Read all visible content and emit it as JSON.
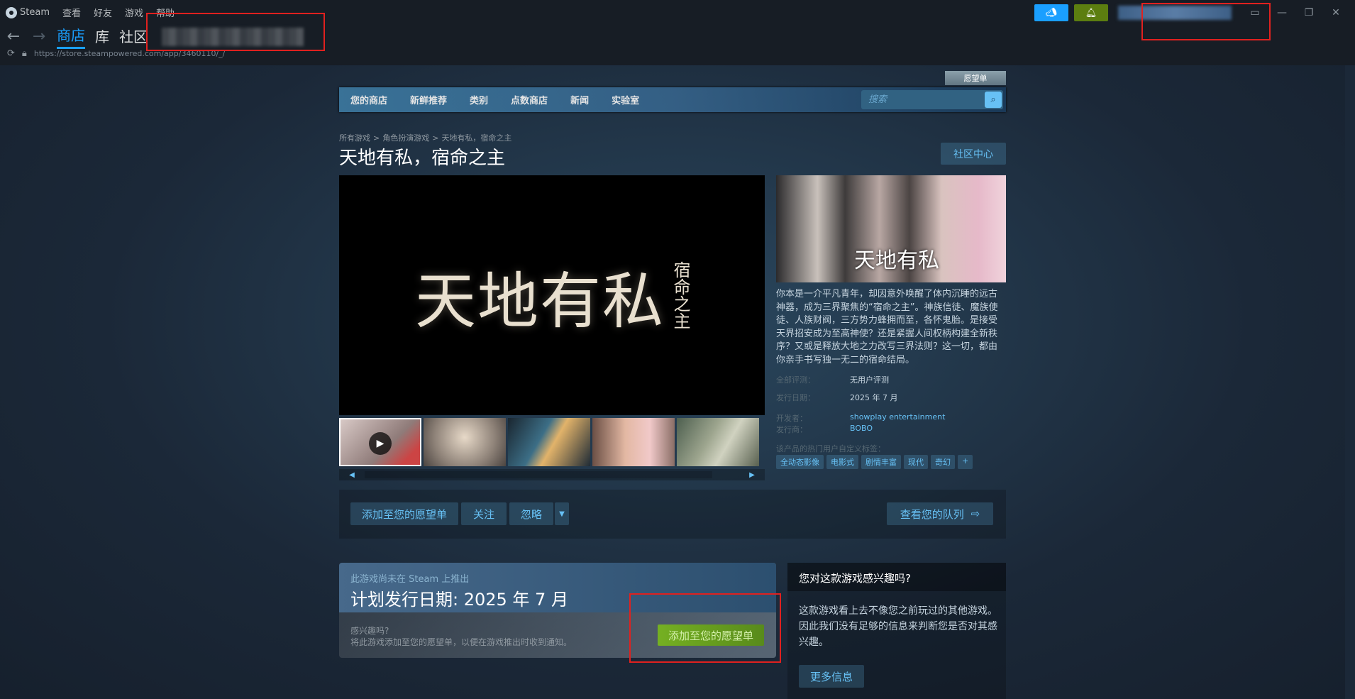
{
  "client": {
    "menu": [
      "Steam",
      "查看",
      "好友",
      "游戏",
      "帮助"
    ],
    "tabs": [
      "商店",
      "库",
      "社区"
    ],
    "url": "https://store.steampowered.com/app/3460110/_/"
  },
  "store": {
    "wishlist_label": "愿望单",
    "nav": [
      "您的商店",
      "新鲜推荐",
      "类别",
      "点数商店",
      "新闻",
      "实验室"
    ],
    "search_placeholder": "搜索"
  },
  "breadcrumb": [
    "所有游戏",
    "角色扮演游戏",
    "天地有私，宿命之主"
  ],
  "game": {
    "title": "天地有私，宿命之主",
    "community_hub": "社区中心",
    "logo_main": "天地有私",
    "logo_side": "宿命之主",
    "description": "你本是一介平凡青年，却因意外唤醒了体内沉睡的远古神器，成为三界聚焦的“宿命之主”。神族信徒、魔族使徒、人族财阀，三方势力蜂拥而至，各怀鬼胎。是接受天界招安成为至高神使？还是紧握人间权柄构建全新秩序？又或是释放大地之力改写三界法则？这一切，都由你亲手书写独一无二的宿命结局。",
    "reviews_label": "全部评测：",
    "reviews_value": "无用户评测",
    "release_label": "发行日期：",
    "release_value": "2025 年 7 月",
    "developer_label": "开发者：",
    "developer_value": "showplay entertainment",
    "publisher_label": "发行商：",
    "publisher_value": "BOBO",
    "tags_label": "该产品的热门用户自定义标签：",
    "tags": [
      "全动态影像",
      "电影式",
      "剧情丰富",
      "现代",
      "奇幻",
      "+"
    ]
  },
  "actions": {
    "add_wishlist": "添加至您的愿望单",
    "follow": "关注",
    "ignore": "忽略",
    "queue": "查看您的队列"
  },
  "upcoming": {
    "not_released": "此游戏尚未在 Steam 上推出",
    "planned": "计划发行日期: 2025 年 7 月",
    "interested": "感兴趣吗?",
    "note": "将此游戏添加至您的愿望单，以便在游戏推出时收到通知。",
    "wishlist_button": "添加至您的愿望单"
  },
  "interest": {
    "heading": "您对这款游戏感兴趣吗?",
    "body": "这款游戏看上去不像您之前玩过的其他游戏。因此我们没有足够的信息来判断您是否对其感兴趣。",
    "more_info": "更多信息"
  },
  "colors": {
    "accent": "#1a9fff",
    "link": "#67c1f5",
    "green": "#75b022",
    "redbox": "#e0211f"
  }
}
